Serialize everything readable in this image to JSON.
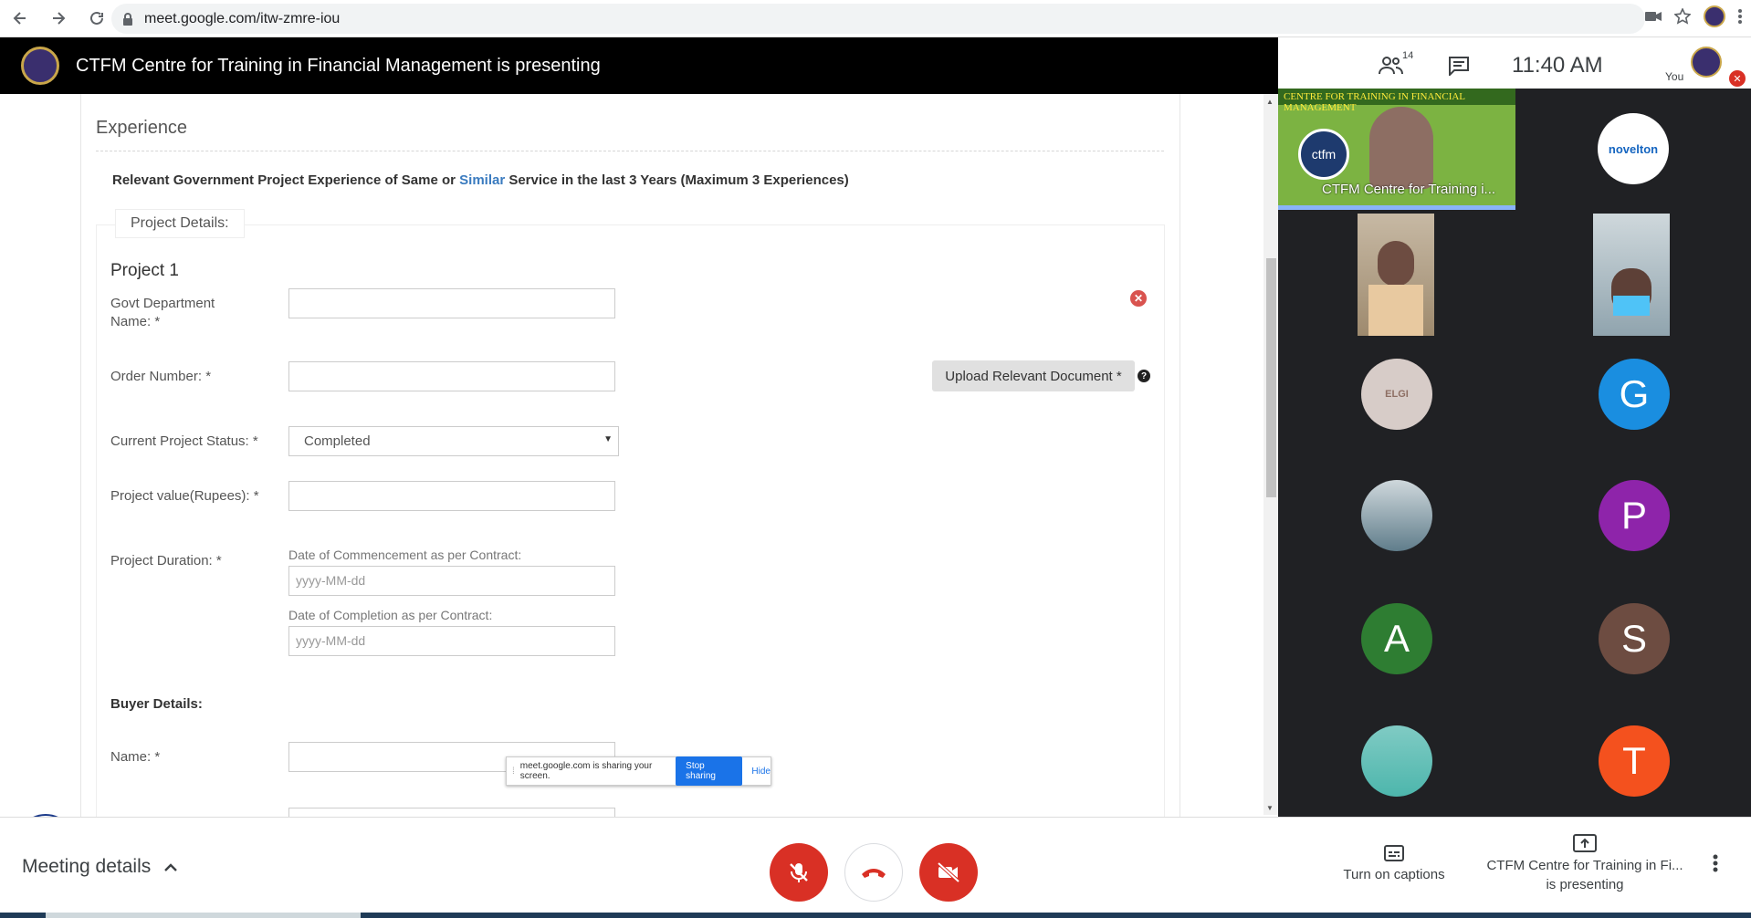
{
  "browser": {
    "url": "meet.google.com/itw-zmre-iou"
  },
  "meet": {
    "presenting_title": "CTFM Centre for Training in Financial Management is presenting",
    "participant_count": "14",
    "clock": "11:40 AM",
    "you_label": "You"
  },
  "form": {
    "section_title": "Experience",
    "intro_before": "Relevant Government Project Experience of Same or ",
    "intro_highlight": "Similar",
    "intro_after": " Service in the last 3 Years (Maximum 3 Experiences)",
    "legend": "Project Details:",
    "project_title": "Project 1",
    "govt_dept_label_line1": "Govt Department",
    "govt_dept_label_line2": "Name: *",
    "order_number_label": "Order Number: *",
    "upload_button": "Upload Relevant Document *",
    "status_label": "Current Project Status: *",
    "status_value": "Completed",
    "value_label": "Project value(Rupees): *",
    "duration_label": "Project Duration: *",
    "commencement_label": "Date of Commencement as per Contract:",
    "commencement_placeholder": "yyyy-MM-dd",
    "completion_label": "Date of Completion as per Contract:",
    "completion_placeholder": "yyyy-MM-dd",
    "buyer_title": "Buyer Details:",
    "buyer_name_label": "Name: *"
  },
  "share_bar": {
    "text": "meet.google.com is sharing your screen.",
    "stop": "Stop sharing",
    "hide": "Hide"
  },
  "participants": {
    "presenter_banner": "CENTRE FOR TRAINING IN FINANCIAL MANAGEMENT",
    "presenter_name": "CTFM Centre for Training i...",
    "presenter_logo": "ctfm",
    "novelton": "novelton",
    "elgi": "ELGI",
    "initials": [
      "G",
      "P",
      "A",
      "S",
      "T"
    ],
    "colors": {
      "G": "#1a8ee0",
      "P": "#8e24aa",
      "A": "#2e7d32",
      "S": "#6d4c41",
      "T": "#f4511e"
    }
  },
  "bottom": {
    "meeting_details": "Meeting details",
    "captions": "Turn on captions",
    "presenting_line1": "CTFM Centre for Training in Fi...",
    "presenting_line2": "is presenting"
  }
}
